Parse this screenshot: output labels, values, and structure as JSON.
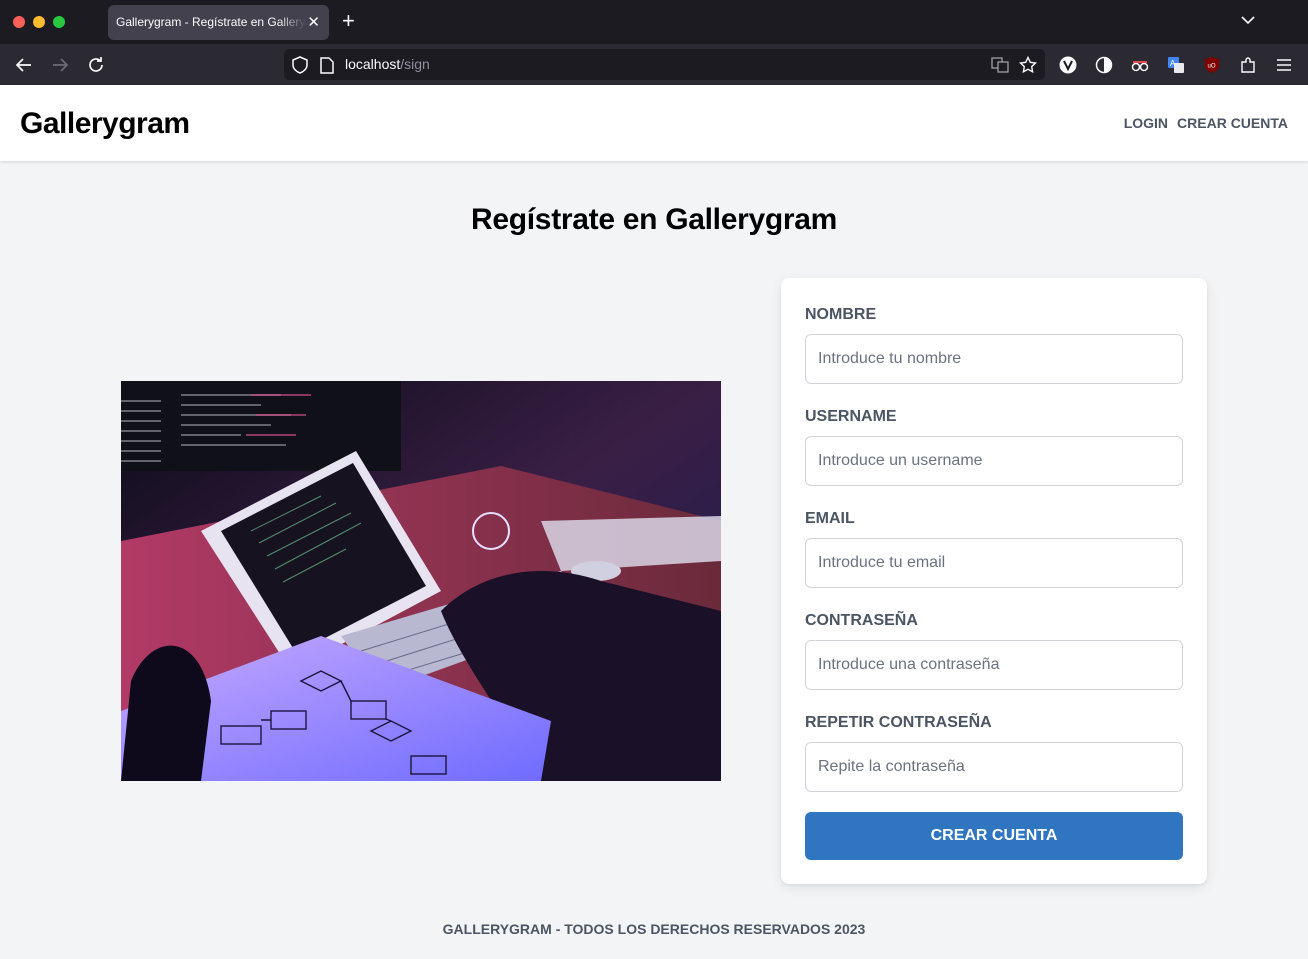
{
  "browser": {
    "tab_title": "Gallerygram - Regístrate en Gallerygram",
    "url_host": "localhost",
    "url_path": "/sign"
  },
  "header": {
    "logo": "Gallerygram",
    "nav": [
      {
        "label": "Login"
      },
      {
        "label": "Crear cuenta"
      }
    ]
  },
  "main": {
    "title": "Regístrate en Gallerygram",
    "form": {
      "fields": [
        {
          "label": "Nombre",
          "placeholder": "Introduce tu nombre",
          "value": ""
        },
        {
          "label": "Username",
          "placeholder": "Introduce un username",
          "value": ""
        },
        {
          "label": "Email",
          "placeholder": "Introduce tu email",
          "value": ""
        },
        {
          "label": "Contraseña",
          "placeholder": "Introduce una contraseña",
          "value": ""
        },
        {
          "label": "Repetir contraseña",
          "placeholder": "Repite la contraseña",
          "value": ""
        }
      ],
      "submit_label": "Crear cuenta"
    }
  },
  "footer": {
    "text": "Gallerygram - Todos los derechos reservados 2023"
  },
  "colors": {
    "primary_button": "#2f75c0",
    "page_bg": "#f3f4f6",
    "label": "#4b5563"
  },
  "icons": [
    "back-arrow-icon",
    "forward-arrow-icon",
    "reload-icon",
    "shield-icon",
    "page-icon",
    "translate-icon",
    "bookmark-star-icon",
    "extension-icons",
    "menu-icon"
  ]
}
